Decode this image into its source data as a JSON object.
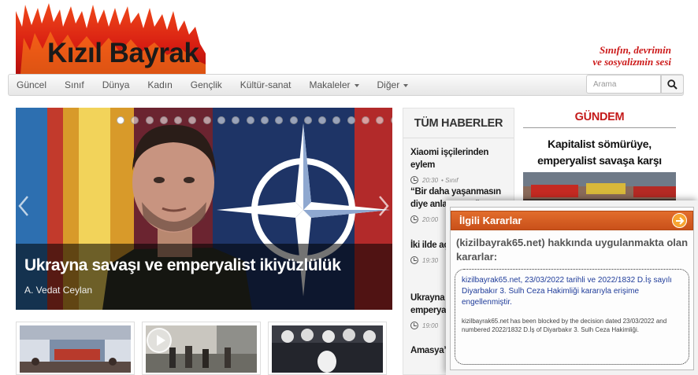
{
  "header": {
    "logo_text": "Kızıl Bayrak",
    "slogan_line1": "Sınıfın, devrimin",
    "slogan_line2": "ve sosyalizmin sesi"
  },
  "nav": {
    "items": [
      "Güncel",
      "Sınıf",
      "Dünya",
      "Kadın",
      "Gençlik",
      "Kültür-sanat",
      "Makaleler",
      "Diğer"
    ],
    "search_placeholder": "Arama"
  },
  "slider": {
    "slide_count": 20,
    "active_index": 0,
    "title": "Ukrayna savaşı ve emperyalist ikiyüzlülük",
    "author": "A. Vedat Ceylan"
  },
  "news": {
    "heading": "TÜM HABERLER",
    "items": [
      {
        "title": "Xiaomi işçilerinden eylem",
        "time": "20:30",
        "category": "Sınıf"
      },
      {
        "title": "“Bir daha yaşanmasın diye anlatıyoruz”",
        "time": "20:00",
        "category": ""
      },
      {
        "title": "İki ilde açıkta kamulaştı",
        "time": "19:30",
        "category": ""
      },
      {
        "title": "Ukrayna savaşı ve emperyalist",
        "time": "19:00",
        "category": ""
      },
      {
        "title": "Amasya’da kazası",
        "time": "",
        "category": ""
      }
    ]
  },
  "gundem": {
    "heading": "GÜNDEM",
    "title": "Kapitalist sömürüye, emperyalist savaşa karşı mücadeleye!"
  },
  "block_notice": {
    "bar_title": "İlgili Kararlar",
    "heading": "(kizilbayrak65.net) hakkında uygulanmakta olan kararlar:",
    "text_tr": "kizilbayrak65.net, 23/03/2022 tarihli ve 2022/1832 D.İş sayılı Diyarbakır 3. Sulh Ceza Hakimliği kararıyla erişime engellenmiştir.",
    "text_en": "kizilbayrak65.net has been blocked by the decision dated 23/03/2022 and numbered 2022/1832 D.İş of Diyarbakır 3. Sulh Ceza Hakimliği."
  },
  "colors": {
    "brand_red": "#cc1a1a",
    "notice_orange": "#d9601f",
    "notice_link_blue": "#1f3c9a"
  },
  "icons": [
    "search-icon",
    "chevron-left-icon",
    "chevron-right-icon",
    "play-icon",
    "clock-icon",
    "arrow-right-circle-icon"
  ]
}
